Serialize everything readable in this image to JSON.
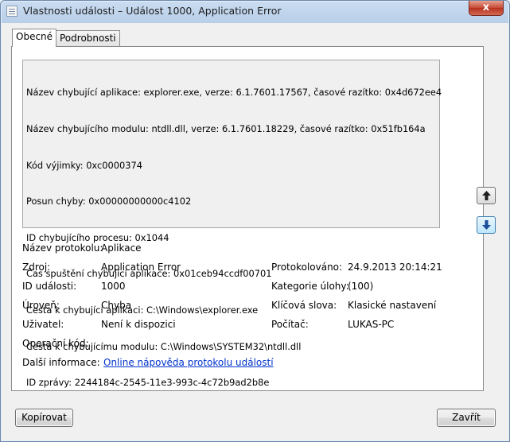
{
  "window": {
    "title": "Vlastnosti události – Událost 1000, Application Error",
    "close_glyph": "x"
  },
  "tabs": [
    {
      "label": "Obecné",
      "active": true
    },
    {
      "label": "Podrobnosti",
      "active": false
    }
  ],
  "message_lines": [
    "Název chybující aplikace: explorer.exe, verze: 6.1.7601.17567, časové razítko: 0x4d672ee4",
    "Název chybujícího modulu: ntdll.dll, verze: 6.1.7601.18229, časové razítko: 0x51fb164a",
    "Kód výjimky: 0xc0000374",
    "Posun chyby: 0x00000000000c4102",
    "ID chybujícího procesu: 0x1044",
    "Čas spuštění chybující aplikace: 0x01ceb94ccdf00701",
    "Cesta k chybující aplikaci: C:\\Windows\\explorer.exe",
    "Cesta k chybujícímu modulu: C:\\Windows\\SYSTEM32\\ntdll.dll",
    "ID zprávy: 2244184c-2545-11e3-993c-4c72b9ad2b8e"
  ],
  "nav": {
    "up_icon": "arrow-up-icon",
    "down_icon": "arrow-down-icon"
  },
  "details": {
    "log_name_label": "Název protokolu:",
    "log_name_value": "Aplikace",
    "source_label": "Zdroj:",
    "source_value": "Application Error",
    "logged_label": "Protokolováno:",
    "logged_value": "24.9.2013 20:14:21",
    "event_id_label": "ID události:",
    "event_id_value": "1000",
    "task_category_label": "Kategorie úlohy:",
    "task_category_value": "(100)",
    "level_label": "Úroveň:",
    "level_value": "Chyba",
    "keywords_label": "Klíčová slova:",
    "keywords_value": "Klasické nastavení",
    "user_label": "Uživatel:",
    "user_value": "Není k dispozici",
    "computer_label": "Počítač:",
    "computer_value": "LUKAS-PC",
    "opcode_label": "Operační kód:",
    "more_info_label": "Další informace:",
    "more_info_link": "Online nápověda protokolu událostí"
  },
  "buttons": {
    "copy": "Kopírovat",
    "close": "Zavřít"
  }
}
